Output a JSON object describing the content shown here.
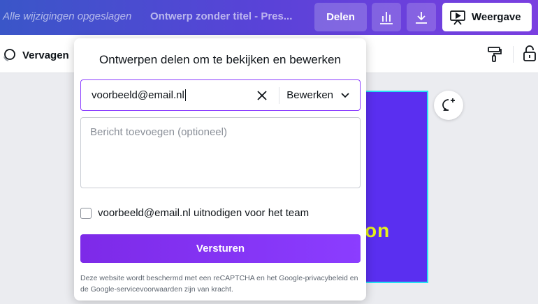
{
  "header": {
    "saved_status": "Alle wijzigingen opgeslagen",
    "doc_title": "Ontwerp zonder titel - Pres...",
    "share_label": "Delen",
    "present_label": "Weergave",
    "stats_icon": "bar-chart-icon",
    "download_icon": "download-icon",
    "present_icon": "presentation-screen-icon"
  },
  "toolbar": {
    "replace_label": "Vervagen",
    "paint_icon": "paint-roller-icon",
    "lock_icon": "lock-icon"
  },
  "canvas": {
    "design_text": "on",
    "comment_icon": "add-comment-icon"
  },
  "share_dialog": {
    "title": "Ontwerpen delen om te bekijken en bewerken",
    "email_value": "voorbeeld@email.nl",
    "permission": "Bewerken",
    "message_placeholder": "Bericht toevoegen (optioneel)",
    "invite_team_label": "voorbeeld@email.nl uitnodigen voor het team",
    "invite_team_checked": false,
    "send_label": "Versturen",
    "recaptcha_notice": "Deze website wordt beschermd met een reCAPTCHA en het Google-privacybeleid en de Google-servicevoorwaarden zijn van kracht."
  },
  "colors": {
    "accent": "#8b3dff",
    "design_background": "#5a2ff0",
    "design_text": "#e6f21a"
  }
}
